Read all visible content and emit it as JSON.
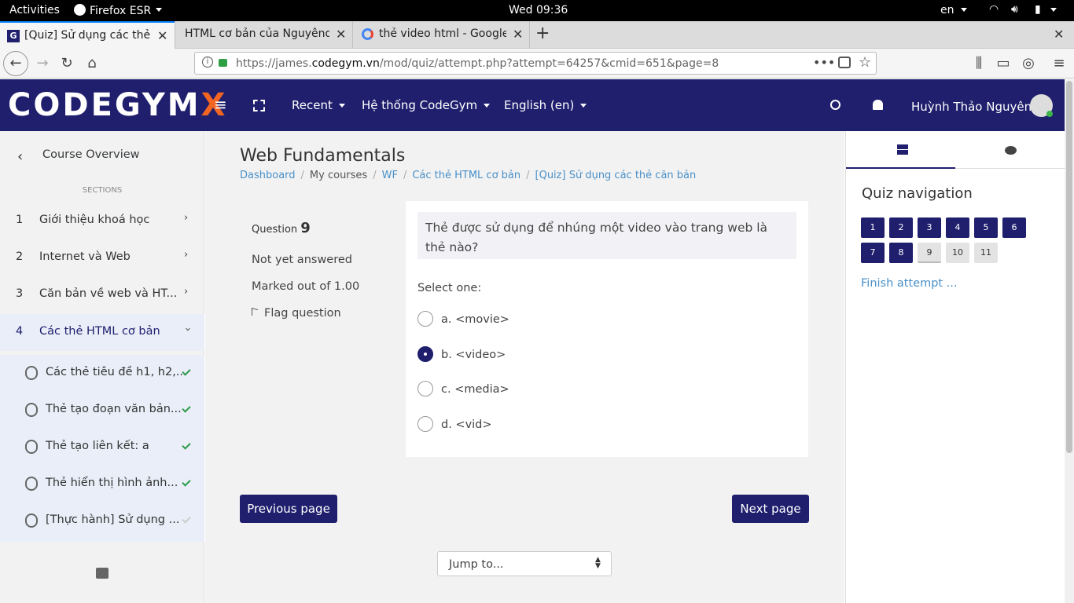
{
  "system": {
    "activities": "Activities",
    "app_name": "Firefox ESR",
    "clock": "Wed 09:36",
    "lang": "en"
  },
  "browser": {
    "tabs": [
      {
        "label": "[Quiz] Sử dụng các thẻ că",
        "active": true
      },
      {
        "label": "HTML cơ bản của Nguyêndg",
        "active": false
      },
      {
        "label": "thẻ video html - Google S",
        "active": false
      }
    ],
    "url_prefix": "https://james.",
    "url_domain": "codegym.vn",
    "url_path": "/mod/quiz/attempt.php?attempt=64257&cmid=651&page=8"
  },
  "header": {
    "logo": "CODEGYM",
    "logo_x": "X",
    "recent": "Recent",
    "system": "Hệ thống CodeGym",
    "language": "English (en)",
    "user_name": "Huỳnh Thảo Nguyên"
  },
  "drawer": {
    "course_overview": "Course Overview",
    "sections_label": "SECTIONS",
    "sections": [
      {
        "num": "1",
        "label": "Giới thiệu khoá học"
      },
      {
        "num": "2",
        "label": "Internet và Web"
      },
      {
        "num": "3",
        "label": "Căn bản về web và HT..."
      },
      {
        "num": "4",
        "label": "Các thẻ HTML cơ bản"
      }
    ],
    "activities": [
      {
        "label": "Các thẻ tiêu đề h1, h2,...",
        "complete": true
      },
      {
        "label": "Thẻ tạo đoạn văn bản...",
        "complete": true
      },
      {
        "label": "Thẻ tạo liên kết: a",
        "complete": true
      },
      {
        "label": "Thẻ hiển thị hình ảnh...",
        "complete": true
      },
      {
        "label": "[Thực hành] Sử dụng ...",
        "complete": false
      }
    ]
  },
  "page": {
    "title": "Web Fundamentals",
    "breadcrumb": [
      "Dashboard",
      "My courses",
      "WF",
      "Các thẻ HTML cơ bản",
      "[Quiz] Sử dụng các thẻ căn bản"
    ]
  },
  "question": {
    "label": "Question",
    "number": "9",
    "status": "Not yet answered",
    "marked": "Marked out of 1.00",
    "flag": "Flag question",
    "text": "Thẻ được sử dụng để nhúng một video vào trang web là thẻ nào?",
    "select_one": "Select one:",
    "options": [
      "a. <movie>",
      "b. <video>",
      "c. <media>",
      "d. <vid>"
    ],
    "selected_index": 1
  },
  "nav": {
    "prev": "Previous page",
    "next": "Next page",
    "jump": "Jump to..."
  },
  "quiz_nav": {
    "title": "Quiz navigation",
    "buttons": [
      "1",
      "2",
      "3",
      "4",
      "5",
      "6",
      "7",
      "8",
      "9",
      "10",
      "11"
    ],
    "answered_count": 8,
    "finish": "Finish attempt ..."
  },
  "colors": {
    "brand": "#1f1f6e",
    "accent_orange": "#f26522",
    "link": "#4a90c8"
  }
}
